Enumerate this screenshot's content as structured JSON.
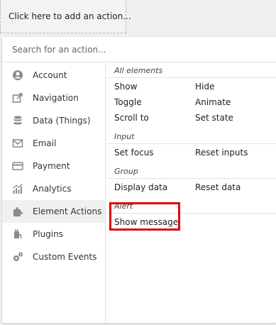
{
  "add_action": {
    "label": "Click here to add an action..."
  },
  "search": {
    "placeholder": "Search for an action...",
    "value": ""
  },
  "categories": [
    {
      "label": "Account",
      "icon": "account-icon"
    },
    {
      "label": "Navigation",
      "icon": "navigation-icon"
    },
    {
      "label": "Data (Things)",
      "icon": "database-icon"
    },
    {
      "label": "Email",
      "icon": "email-icon"
    },
    {
      "label": "Payment",
      "icon": "payment-icon"
    },
    {
      "label": "Analytics",
      "icon": "analytics-icon"
    },
    {
      "label": "Element Actions",
      "icon": "puzzle-icon",
      "selected": true
    },
    {
      "label": "Plugins",
      "icon": "plugin-icon"
    },
    {
      "label": "Custom Events",
      "icon": "gears-icon"
    }
  ],
  "groups": {
    "all_elements": {
      "title": "All elements",
      "actions": [
        "Show",
        "Hide",
        "Toggle",
        "Animate",
        "Scroll to",
        "Set state"
      ]
    },
    "input": {
      "title": "Input",
      "actions": [
        "Set focus",
        "Reset inputs"
      ]
    },
    "group": {
      "title": "Group",
      "actions": [
        "Display data",
        "Reset data"
      ]
    },
    "alert": {
      "title": "Alert",
      "actions": [
        "Show message"
      ]
    }
  },
  "colors": {
    "highlight": "#e00000",
    "selected_bg": "#f0f0f0",
    "icon": "#8a8a8a"
  }
}
